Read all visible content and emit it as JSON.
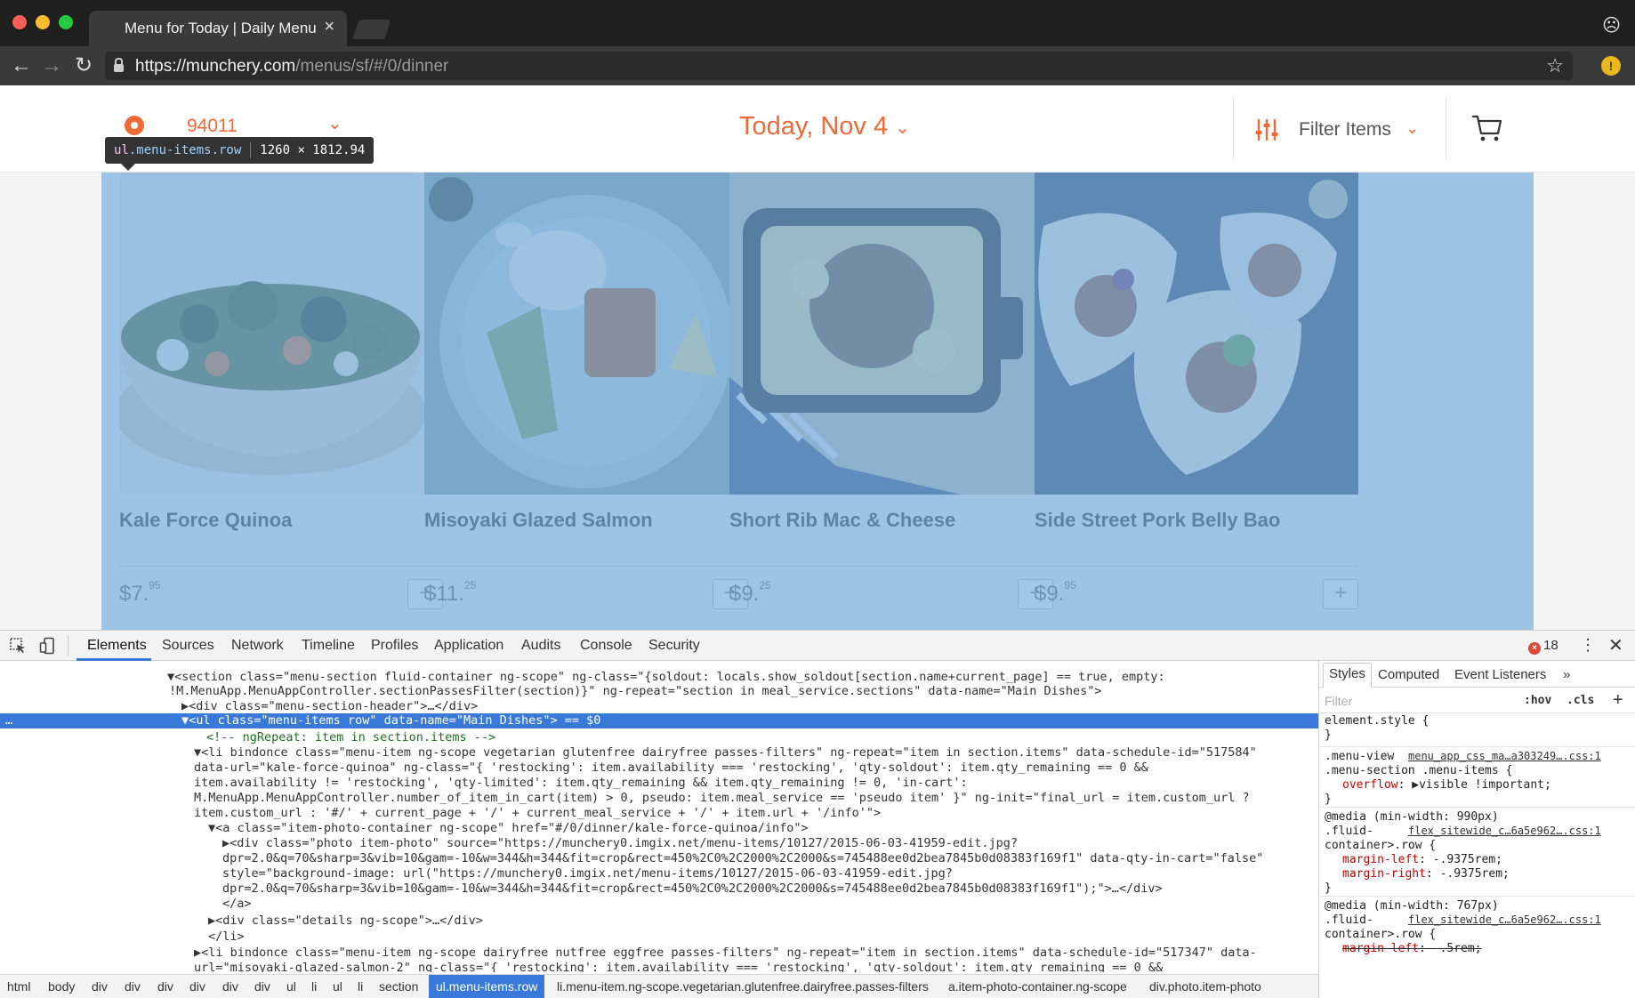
{
  "browser": {
    "tab_title": "Menu for Today | Daily Menu |",
    "tab_close": "×",
    "url_host": "https://munchery.com",
    "url_path": "/menus/sf/#/0/dinner",
    "back_glyph": "←",
    "forward_glyph": "→",
    "reload_glyph": "↻",
    "star_glyph": "☆",
    "profile_glyph": "☹",
    "ext_glyph": "!"
  },
  "site": {
    "zip": "94011",
    "zip_caret": "⌄",
    "date": "Today, Nov 4",
    "date_caret": "⌄",
    "filter_label": "Filter Items",
    "filter_caret": "⌄",
    "accent_color": "#f06a35"
  },
  "inspect_tip": {
    "tag": "ul",
    "class": ".menu-items.row",
    "size": "1260 × 1812.94"
  },
  "menu_items": [
    {
      "name": "Kale Force Quinoa",
      "price_main": "$7.",
      "price_cents": "95",
      "add": "+"
    },
    {
      "name": "Misoyaki Glazed Salmon",
      "price_main": "$11.",
      "price_cents": "25",
      "add": "+"
    },
    {
      "name": "Short Rib Mac & Cheese",
      "price_main": "$9.",
      "price_cents": "25",
      "add": "+"
    },
    {
      "name": "Side Street Pork Belly Bao",
      "price_main": "$9.",
      "price_cents": "95",
      "add": "+"
    }
  ],
  "devtools": {
    "tabs": [
      "Elements",
      "Sources",
      "Network",
      "Timeline",
      "Profiles",
      "Application",
      "Audits",
      "Console",
      "Security"
    ],
    "error_count": "18",
    "error_glyph": "×",
    "more_glyph": "⋮",
    "close_glyph": "✕",
    "dom_lines": [
      "▼<section class=\"menu-section fluid-container ng-scope\" ng-class=\"{soldout: locals.show_soldout[section.name+current_page] == true, empty:",
      "!M.MenuApp.MenuAppController.sectionPassesFilter(section)}\" ng-repeat=\"section in meal_service.sections\" data-name=\"Main Dishes\">",
      "▶<div class=\"menu-section-header\">…</div>",
      "▼<ul class=\"menu-items row\" data-name=\"Main Dishes\"> == $0",
      "<!-- ngRepeat: item in section.items -->",
      "▼<li bindonce class=\"menu-item ng-scope vegetarian glutenfree dairyfree passes-filters\" ng-repeat=\"item in section.items\" data-schedule-id=\"517584\"",
      "data-url=\"kale-force-quinoa\" ng-class=\"{ 'restocking': item.availability === 'restocking', 'qty-soldout': item.qty_remaining == 0 &&",
      "item.availability != 'restocking', 'qty-limited': item.qty_remaining && item.qty_remaining != 0, 'in-cart':",
      "M.MenuApp.MenuAppController.number_of_item_in_cart(item) > 0, pseudo: item.meal_service == 'pseudo item' }\" ng-init=\"final_url = item.custom_url ?",
      "item.custom_url : '#/' + current_page + '/' + current_meal_service + '/' + item.url + '/info'\">",
      "▼<a class=\"item-photo-container ng-scope\" href=\"#/0/dinner/kale-force-quinoa/info\">",
      "▶<div class=\"photo item-photo\" source=\"https://munchery0.imgix.net/menu-items/10127/2015-06-03-41959-edit.jpg?",
      "dpr=2.0&q=70&sharp=3&vib=10&gam=-10&w=344&h=344&fit=crop&rect=450%2C0%2C2000%2C2000&s=745488ee0d2bea7845b0d08383f169f1\" data-qty-in-cart=\"false\"",
      "style=\"background-image: url(\"https://munchery0.imgix.net/menu-items/10127/2015-06-03-41959-edit.jpg?",
      "dpr=2.0&q=70&sharp=3&vib=10&gam=-10&w=344&h=344&fit=crop&rect=450%2C0%2C2000%2C2000&s=745488ee0d2bea7845b0d08383f169f1\");\">…</div>",
      "</a>",
      "▶<div class=\"details ng-scope\">…</div>",
      "</li>",
      "▶<li bindonce class=\"menu-item ng-scope dairyfree nutfree eggfree passes-filters\" ng-repeat=\"item in section.items\" data-schedule-id=\"517347\" data-",
      "url=\"misoyaki-glazed-salmon-2\" ng-class=\"{ 'restocking': item.availability === 'restocking', 'qty-soldout': item.qty_remaining == 0 &&"
    ],
    "dom_gutter": "…",
    "breadcrumbs": [
      "html",
      "body",
      "div",
      "div",
      "div",
      "div",
      "div",
      "div",
      "ul",
      "li",
      "ul",
      "li",
      "section",
      "ul.menu-items.row",
      "li.menu-item.ng-scope.vegetarian.glutenfree.dairyfree.passes-filters",
      "a.item-photo-container.ng-scope",
      "div.photo.item-photo"
    ],
    "styles_tabs": [
      "Styles",
      "Computed",
      "Event Listeners",
      "»"
    ],
    "filter_placeholder": "Filter",
    "hov": ":hov",
    "cls": ".cls",
    "add_rule": "+",
    "css": {
      "element_style": "element.style {",
      "close": "}",
      "rule1_sel1": ".menu-view",
      "rule1_link": "menu_app_css_ma…a303249….css:1",
      "rule1_sel2": ".menu-section .menu-items {",
      "rule1_prop": "overflow",
      "rule1_val": ": ▶visible !important;",
      "media1": "@media (min-width: 990px)",
      "rule2_sel1": ".fluid-",
      "rule2_link": "flex_sitewide_c…6a5e962….css:1",
      "rule2_sel2": "container>.row {",
      "rule2_p1": "margin-left",
      "rule2_v1": ": -.9375rem;",
      "rule2_p2": "margin-right",
      "rule2_v2": ": -.9375rem;",
      "media2": "@media (min-width: 767px)",
      "rule3_sel1": ".fluid-",
      "rule3_link": "flex_sitewide_c…6a5e962….css:1",
      "rule3_sel2": "container>.row {",
      "rule3_p1": "margin-left",
      "rule3_v1": ": -.5rem;"
    }
  }
}
